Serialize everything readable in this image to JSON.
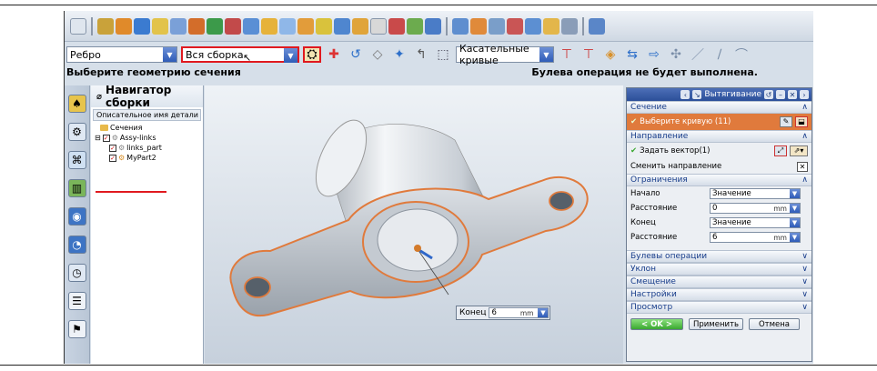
{
  "select_bar": {
    "edge_filter": "Ребро",
    "scope": "Вся сборка",
    "curve_rule": "Касательные кривые"
  },
  "status": {
    "prompt": "Выберите геометрию сечения",
    "message": "Булева операция не будет выполнена."
  },
  "navigator": {
    "title": "Навигатор сборки",
    "column_header": "Описательное имя детали",
    "items": [
      {
        "label": "Сечения",
        "indent": 1
      },
      {
        "label": "Assy-links",
        "indent": 1
      },
      {
        "label": "links_part",
        "indent": 2
      },
      {
        "label": "MyPart2",
        "indent": 2
      }
    ]
  },
  "dialog": {
    "title": "Вытягивание",
    "section_label": "Сечение",
    "select_curve": "Выберите кривую (11)",
    "direction_label": "Направление",
    "specify_vector": "Задать вектор(1)",
    "reverse_direction": "Сменить направление",
    "limits_label": "Ограничения",
    "start_label": "Начало",
    "start_value": "Значение",
    "distance_label": "Расстояние",
    "start_distance": "0",
    "end_label": "Конец",
    "end_value": "Значение",
    "end_distance": "6",
    "unit": "mm",
    "collapsed_sections": [
      "Булевы операции",
      "Уклон",
      "Смещение",
      "Настройки",
      "Просмотр"
    ],
    "ok": "< OK >",
    "apply": "Применить",
    "cancel": "Отмена"
  },
  "end_popup": {
    "label": "Конец",
    "value": "6",
    "unit": "mm"
  },
  "colors": {
    "highlight_red": "#e0191f",
    "section_orange": "#e07a3c",
    "dialog_title_blue": "#2b4f99"
  }
}
